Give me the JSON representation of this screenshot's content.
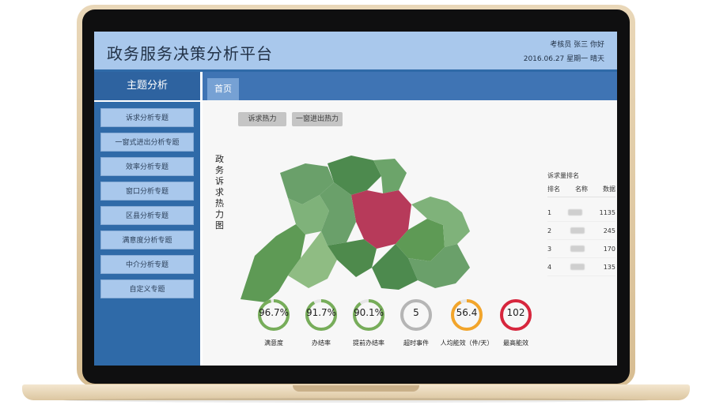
{
  "header": {
    "title": "政务服务决策分析平台",
    "user": "考核员 张三 你好",
    "date": "2016.06.27 星期一 晴天"
  },
  "sidebar": {
    "title": "主题分析",
    "items": [
      {
        "label": "诉求分析专题"
      },
      {
        "label": "一窗式进出分析专题"
      },
      {
        "label": "效率分析专题"
      },
      {
        "label": "窗口分析专题"
      },
      {
        "label": "区县分析专题"
      },
      {
        "label": "满意度分析专题"
      },
      {
        "label": "中介分析专题"
      },
      {
        "label": "自定义专题"
      }
    ]
  },
  "main": {
    "tab_home": "首页",
    "buttons": [
      "诉求热力",
      "一窗进出热力"
    ],
    "map_title": "政务诉求热力图"
  },
  "ranking": {
    "title": "诉求量排名",
    "headers": [
      "排名",
      "名称",
      "数据"
    ],
    "rows": [
      {
        "rank": "1",
        "value": "1135"
      },
      {
        "rank": "2",
        "value": "245"
      },
      {
        "rank": "3",
        "value": "170"
      },
      {
        "rank": "4",
        "value": "135"
      }
    ]
  },
  "stats": [
    {
      "value": "96.7%",
      "label": "满意度",
      "color": "#77ad5a",
      "pct": 0.967
    },
    {
      "value": "91.7%",
      "label": "办结率",
      "color": "#77ad5a",
      "pct": 0.917
    },
    {
      "value": "90.1%",
      "label": "提前办结率",
      "color": "#77ad5a",
      "pct": 0.901
    },
    {
      "value": "5",
      "label": "超时事件",
      "color": "#b5b5b5",
      "pct": 1.0
    },
    {
      "value": "56.4",
      "label": "人均能效（件/天）",
      "color": "#f2a52b",
      "pct": 0.93
    },
    {
      "value": "102",
      "label": "最高能效",
      "color": "#d7263d",
      "pct": 1.0
    }
  ],
  "colors": {
    "header_bg": "#a9c8ec",
    "sidebar_bg": "#2f6aa8",
    "tab_bg": "#3f74b4",
    "map_hot": "#b73a5a",
    "map_green": "#4e8a4c"
  }
}
